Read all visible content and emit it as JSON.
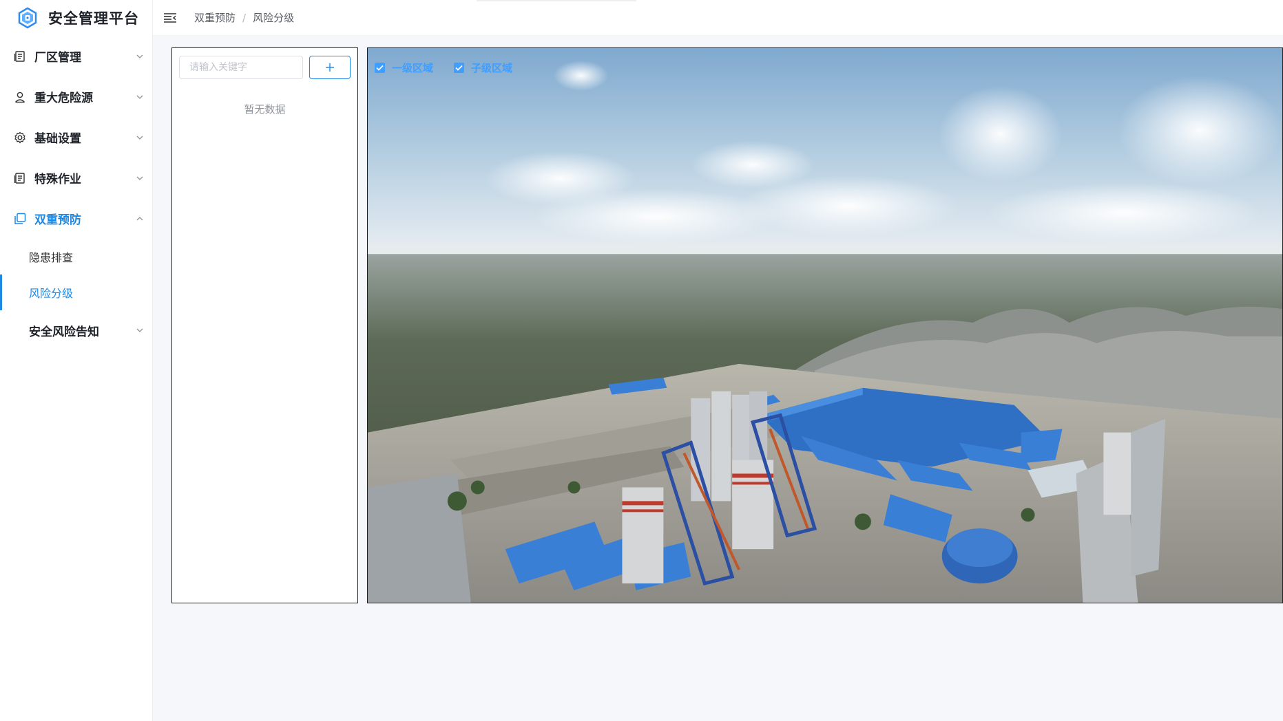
{
  "app": {
    "title": "安全管理平台"
  },
  "sidebar": {
    "items": [
      {
        "label": "厂区管理",
        "icon": "document-icon",
        "expanded": false
      },
      {
        "label": "重大危险源",
        "icon": "user-icon",
        "expanded": false
      },
      {
        "label": "基础设置",
        "icon": "gear-icon",
        "expanded": false
      },
      {
        "label": "特殊作业",
        "icon": "document-icon",
        "expanded": false
      },
      {
        "label": "双重预防",
        "icon": "copy-icon",
        "expanded": true,
        "children": [
          {
            "label": "隐患排查",
            "active": false
          },
          {
            "label": "风险分级",
            "active": true
          }
        ]
      },
      {
        "label": "安全风险告知",
        "expanded": false
      }
    ]
  },
  "header": {
    "breadcrumb": [
      "双重预防",
      "风险分级"
    ],
    "separator": "/"
  },
  "tree": {
    "search_placeholder": "请输入关键字",
    "add_button": "+",
    "empty_text": "暂无数据"
  },
  "map": {
    "layers": [
      {
        "label": "一级区域",
        "checked": true
      },
      {
        "label": "子级区域",
        "checked": true
      }
    ]
  },
  "colors": {
    "accent": "#1e88e5",
    "checkbox": "#409eff"
  }
}
